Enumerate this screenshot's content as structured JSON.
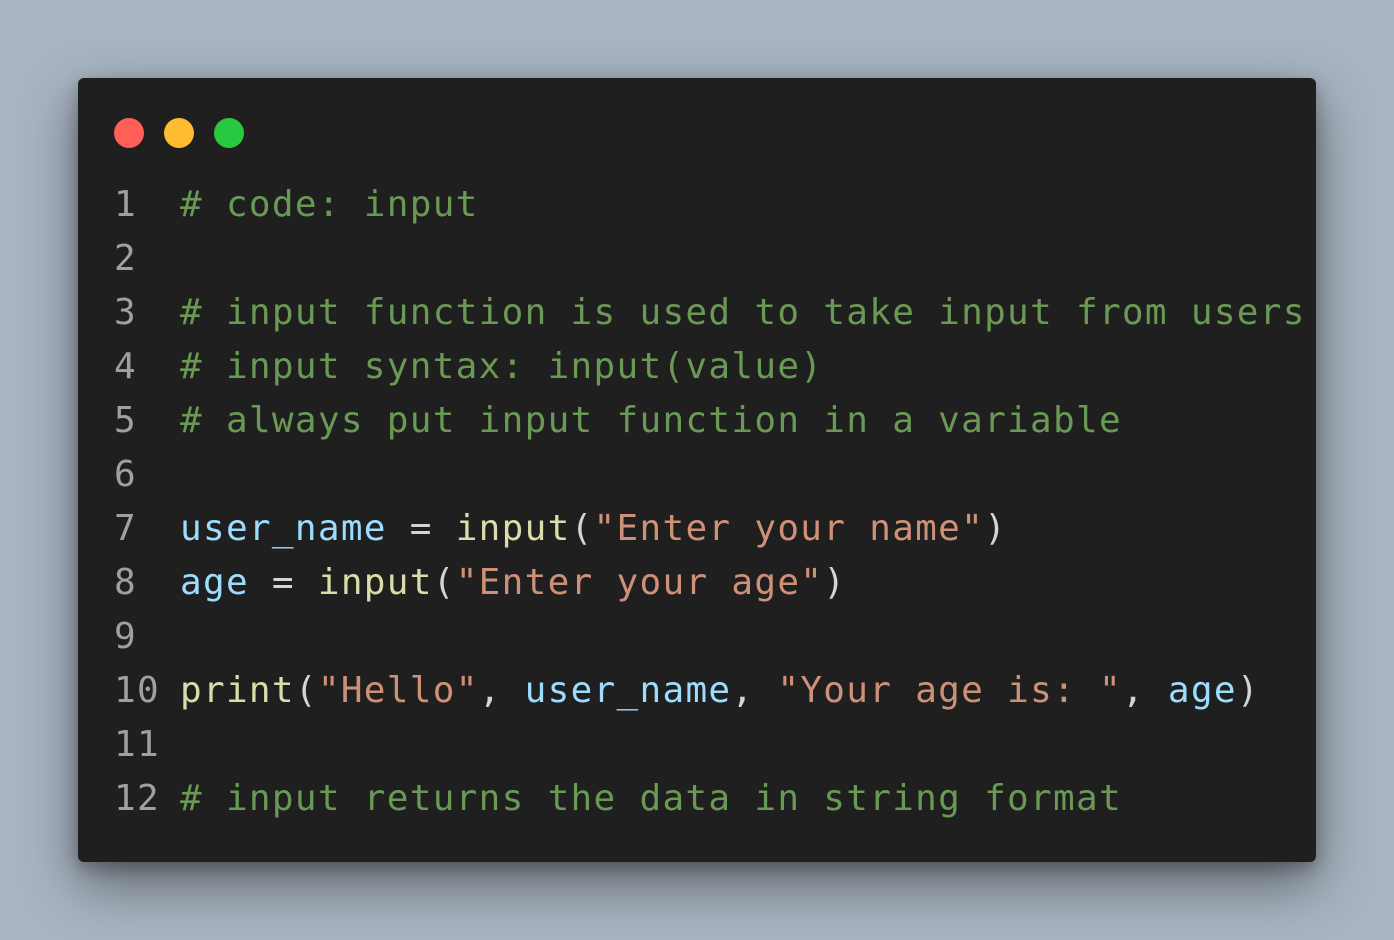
{
  "window": {
    "controls": [
      {
        "name": "close",
        "color": "#ff5f57"
      },
      {
        "name": "minimize",
        "color": "#febc2e"
      },
      {
        "name": "maximize",
        "color": "#28c840"
      }
    ]
  },
  "code": {
    "language": "python",
    "lines": [
      {
        "number": "1",
        "tokens": [
          {
            "t": "comment",
            "v": "# code: input"
          }
        ]
      },
      {
        "number": "2",
        "tokens": []
      },
      {
        "number": "3",
        "tokens": [
          {
            "t": "comment",
            "v": "# input function is used to take input from users"
          }
        ]
      },
      {
        "number": "4",
        "tokens": [
          {
            "t": "comment",
            "v": "# input syntax: input(value)"
          }
        ]
      },
      {
        "number": "5",
        "tokens": [
          {
            "t": "comment",
            "v": "# always put input function in a variable"
          }
        ]
      },
      {
        "number": "6",
        "tokens": []
      },
      {
        "number": "7",
        "tokens": [
          {
            "t": "var",
            "v": "user_name"
          },
          {
            "t": "punc",
            "v": " = "
          },
          {
            "t": "fn",
            "v": "input"
          },
          {
            "t": "punc",
            "v": "("
          },
          {
            "t": "str",
            "v": "\"Enter your name\""
          },
          {
            "t": "punc",
            "v": ")"
          }
        ]
      },
      {
        "number": "8",
        "tokens": [
          {
            "t": "var",
            "v": "age"
          },
          {
            "t": "punc",
            "v": " = "
          },
          {
            "t": "fn",
            "v": "input"
          },
          {
            "t": "punc",
            "v": "("
          },
          {
            "t": "str",
            "v": "\"Enter your age\""
          },
          {
            "t": "punc",
            "v": ")"
          }
        ]
      },
      {
        "number": "9",
        "tokens": []
      },
      {
        "number": "10",
        "tokens": [
          {
            "t": "fn",
            "v": "print"
          },
          {
            "t": "punc",
            "v": "("
          },
          {
            "t": "str",
            "v": "\"Hello\""
          },
          {
            "t": "punc",
            "v": ", "
          },
          {
            "t": "var",
            "v": "user_name"
          },
          {
            "t": "punc",
            "v": ", "
          },
          {
            "t": "str",
            "v": "\"Your age is: \""
          },
          {
            "t": "punc",
            "v": ", "
          },
          {
            "t": "var",
            "v": "age"
          },
          {
            "t": "punc",
            "v": ")"
          }
        ]
      },
      {
        "number": "11",
        "tokens": []
      },
      {
        "number": "12",
        "tokens": [
          {
            "t": "comment",
            "v": "# input returns the data in string format"
          }
        ]
      }
    ]
  }
}
